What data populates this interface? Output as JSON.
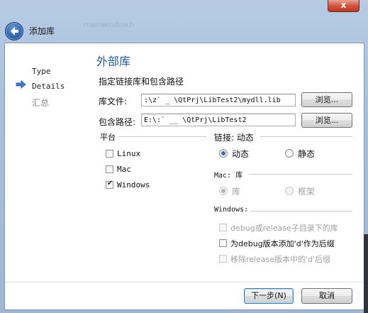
{
  "window": {
    "close_label": "x",
    "title": "添加库",
    "ghost_title": "mainwindow.h"
  },
  "sidebar": {
    "items": [
      {
        "label": "Type",
        "active": false
      },
      {
        "label": "Details",
        "active": true
      },
      {
        "label": "汇总",
        "active": false
      }
    ]
  },
  "page": {
    "title": "外部库",
    "subtitle": "指定链接库和包含路径"
  },
  "library_file": {
    "label": "库文件:",
    "value": ":\\z`   _   \\QtPrj\\LibTest2\\mydll.lib",
    "browse_label": "浏览..."
  },
  "include_path": {
    "label": "包含路径:",
    "value": "E:\\:`   __  \\QtPrj\\LibTest2",
    "browse_label": "浏览..."
  },
  "platform": {
    "title": "平台",
    "options": [
      {
        "label": "Linux",
        "checked": false
      },
      {
        "label": "Mac",
        "checked": false
      },
      {
        "label": "Windows",
        "checked": true
      }
    ]
  },
  "linkage": {
    "title": "链接: 动态",
    "options": [
      {
        "label": "动态",
        "selected": true
      },
      {
        "label": "静态",
        "selected": false
      }
    ]
  },
  "mac": {
    "title": "Mac: 库",
    "options": [
      {
        "label": "库",
        "selected": true
      },
      {
        "label": "框架",
        "selected": false
      }
    ]
  },
  "windows": {
    "title": "Windows:",
    "options": [
      {
        "label": "debug或release子目录下的库",
        "checked": false,
        "enabled": false
      },
      {
        "label": "为debug版本添加'd'作为后缀",
        "checked": false,
        "enabled": true
      },
      {
        "label": "移除release版本中的'd'后缀",
        "checked": false,
        "enabled": false
      }
    ]
  },
  "footer": {
    "next_label": "下一步(N)",
    "cancel_label": "取消"
  }
}
